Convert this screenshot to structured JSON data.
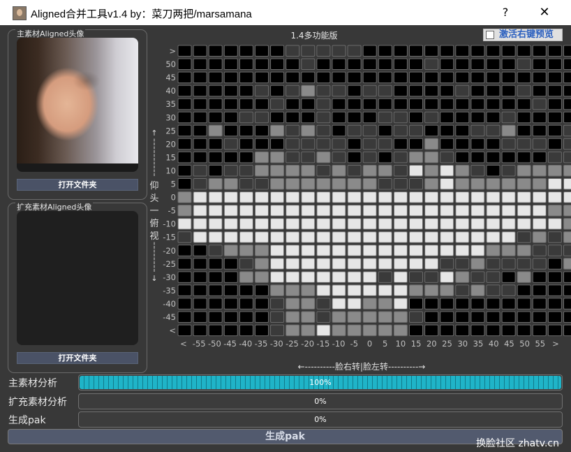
{
  "window": {
    "title": "Aligned合并工具v1.4  by：菜刀两把/marsamana",
    "help_label": "?",
    "close_label": "✕"
  },
  "main_material": {
    "title": "主素材Aligned头像",
    "open_button": "打开文件夹"
  },
  "ext_material": {
    "title": "扩充素材Aligned头像",
    "open_button": "打开文件夹"
  },
  "grid": {
    "title": "1.4多功能版",
    "preview_checkbox": {
      "label": "激活右键预览",
      "checked": false
    },
    "vertical_axis_chars": [
      "仰",
      "头",
      "一",
      "俯",
      "视"
    ],
    "horizontal_axis_label": "←----------脸右转|脸左转----------→",
    "y_labels": [
      ">",
      "50",
      "45",
      "40",
      "35",
      "30",
      "25",
      "20",
      "15",
      "10",
      "5",
      "0",
      "-5",
      "-10",
      "-15",
      "-20",
      "-25",
      "-30",
      "-35",
      "-40",
      "-45",
      "<"
    ],
    "x_labels": [
      "<",
      "-55",
      "-50",
      "-45",
      "-40",
      "-35",
      "-30",
      "-25",
      "-20",
      "-15",
      "-10",
      "-5",
      "0",
      "5",
      "10",
      "15",
      "20",
      "25",
      "30",
      "35",
      "40",
      "45",
      "50",
      "55",
      ">"
    ],
    "colors": {
      "0": "#000000",
      "1": "#3a3a3a",
      "2": "#8a8a8a",
      "3": "#e6e6e6"
    },
    "cells": [
      "00000001111100000000000000",
      "00000000100000001000001000",
      "00000000000000000000000000",
      "00000101211011000010001000",
      "00000010010000000000000100",
      "00001100010001101000010000",
      "00200021210110110001120001",
      "00010001111011002000011101",
      "00000221121010122100000011",
      "01011222212122132321012222",
      "01221122222221112322222233",
      "23333333333333333333333333",
      "23333333333333333333333322",
      "33333333333333333333333332",
      "13333333333333333333331212",
      "00122233333333333333222111",
      "00001233333333333112111102",
      "00002233333331311321102000",
      "00000022233333322212110000",
      "00000012213322300000000000",
      "00000012212222210000000000",
      "00000012232222200000000000"
    ]
  },
  "progress": [
    {
      "label": "主素材分析",
      "value_text": "100%",
      "fraction": 1.0
    },
    {
      "label": "扩充素材分析",
      "value_text": "0%",
      "fraction": 0.0
    },
    {
      "label": "生成pak",
      "value_text": "0%",
      "fraction": 0.0
    }
  ],
  "generate_button": "生成pak",
  "watermark": "换脸社区 zhatv.cn"
}
